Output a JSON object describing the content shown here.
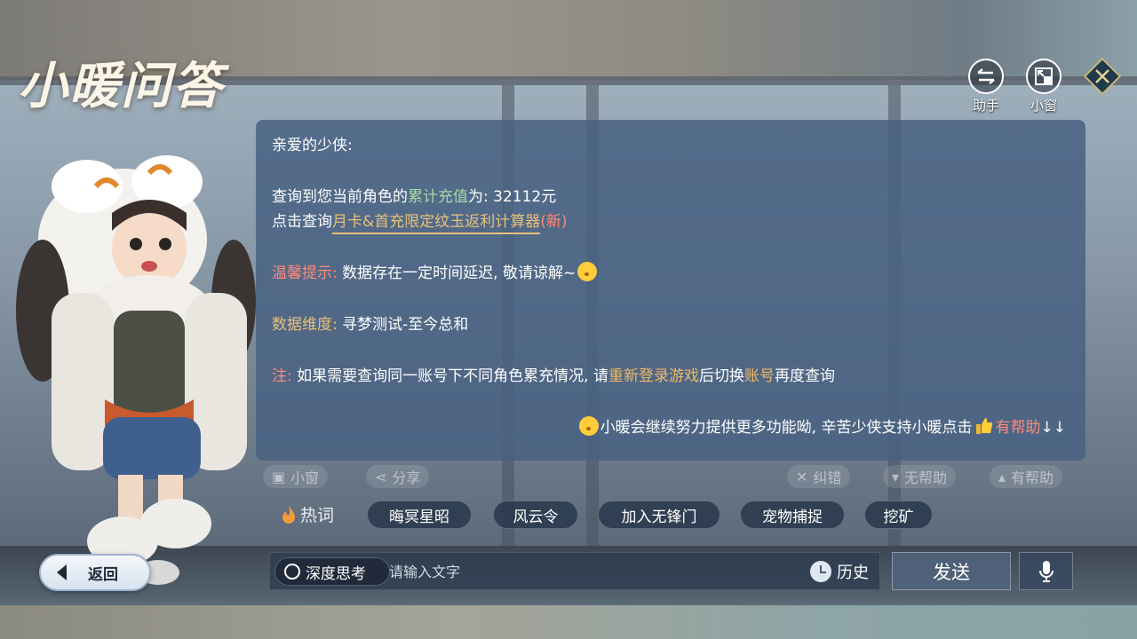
{
  "header": {
    "title": "小暖问答",
    "assistant_label": "助手",
    "small_window_label": "小窗"
  },
  "message": {
    "greeting": "亲爱的少侠:",
    "line1_prefix": "查询到您当前角色的",
    "line1_highlight": "累计充值",
    "line1_suffix": "为: 32112元",
    "line2_prefix": "点击查询",
    "line2_link": "月卡&首充限定纹玉返利计算器",
    "line2_tag": "(新)",
    "tip_label": "温馨提示:",
    "tip_text": "数据存在一定时间延迟, 敬请谅解~",
    "dimension_label": "数据维度:",
    "dimension_text": "寻梦测试-至今总和",
    "note_label": "注:",
    "note_text1": "如果需要查询同一账号下不同角色累充情况, 请",
    "note_highlight1": "重新登录游戏",
    "note_text2": "后切换",
    "note_highlight2": "账号",
    "note_text3": "再度查询",
    "footer_text": "小暖会继续努力提供更多功能呦, 辛苦少侠支持小暖点击",
    "footer_link": "有帮助",
    "footer_arrows": "↓↓"
  },
  "actions": {
    "small_window": "小窗",
    "share": "分享",
    "correct": "纠错",
    "unhelpful": "无帮助",
    "helpful": "有帮助"
  },
  "hot": {
    "label": "热词",
    "chips": [
      "晦冥星昭",
      "风云令",
      "加入无锋门",
      "宠物捕捉",
      "挖矿"
    ]
  },
  "bottom": {
    "back_label": "返回",
    "deep_think_label": "深度思考",
    "input_placeholder": "请输入文字",
    "history_label": "历史",
    "send_label": "发送"
  },
  "colors": {
    "panel": "#4a6382",
    "gold": "#e8c07a",
    "green": "#a6d9a6",
    "red": "#ff8a7a"
  }
}
